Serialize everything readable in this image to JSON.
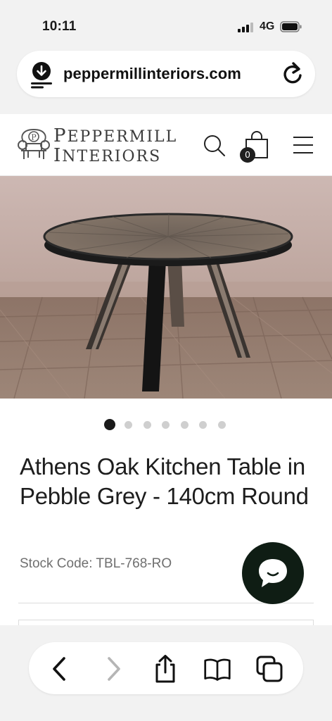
{
  "status_bar": {
    "time": "10:11",
    "network": "4G"
  },
  "browser": {
    "url": "peppermillinteriors.com",
    "toolbar_icons": [
      "back-icon",
      "forward-icon",
      "share-icon",
      "bookmarks-icon",
      "tabs-icon"
    ]
  },
  "site": {
    "logo_line1_cap": "P",
    "logo_line1_rest": "EPPERMILL",
    "logo_line2_cap": "I",
    "logo_line2_rest": "NTERIORS",
    "logo_mark_letter": "P",
    "cart_count": "0"
  },
  "gallery": {
    "total_images": 7,
    "active_index": 0
  },
  "product": {
    "title": "Athens Oak Kitchen Table in Pebble Grey - 140cm Round",
    "stock_code": "Stock Code: TBL-768-RO"
  },
  "colors": {
    "chat_button": "#0f1d14",
    "active_dot": "#1a1a1a",
    "inactive_dot": "#cfcfcf"
  }
}
